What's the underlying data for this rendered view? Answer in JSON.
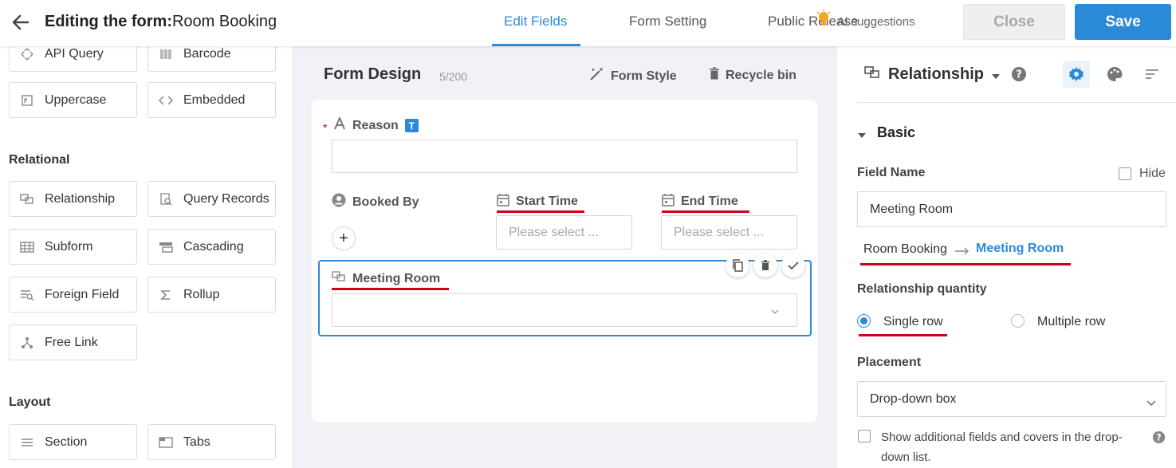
{
  "header": {
    "title_prefix": "Editing the form:",
    "title_name": "Room Booking",
    "tabs": [
      "Edit Fields",
      "Form Setting",
      "Public Release"
    ],
    "suggestions": "Ai suggestions",
    "close_label": "Close",
    "save_label": "Save",
    "accent": "#2b8ad8"
  },
  "left": {
    "top_buttons": [
      "API Query",
      "Barcode",
      "Uppercase",
      "Embedded"
    ],
    "relational_label": "Relational",
    "relational": [
      "Relationship",
      "Query Records",
      "Subform",
      "Cascading",
      "Foreign Field",
      "Rollup",
      "Free Link"
    ],
    "layout_label": "Layout",
    "layout": [
      "Section",
      "Tabs"
    ]
  },
  "canvas": {
    "title": "Form Design",
    "count": "5/200",
    "form_style": "Form Style",
    "recycle_bin": "Recycle bin",
    "fields": {
      "reason": "Reason",
      "reason_badge": "T",
      "required_mark": "*",
      "booked_by": "Booked By",
      "start_time": "Start Time",
      "end_time": "End Time",
      "select_placeholder": "Please select ...",
      "meeting_room": "Meeting Room"
    }
  },
  "props": {
    "field_type": "Relationship",
    "section": "Basic",
    "field_name_label": "Field Name",
    "hide_label": "Hide",
    "field_name_value": "Meeting Room",
    "relation_from": "Room Booking",
    "relation_to": "Meeting Room",
    "quantity_label": "Relationship quantity",
    "single_row": "Single row",
    "multiple_row": "Multiple row",
    "placement_label": "Placement",
    "placement_value": "Drop-down box",
    "show_additional": "Show additional fields and covers in the drop-",
    "show_additional_2": "down list."
  }
}
